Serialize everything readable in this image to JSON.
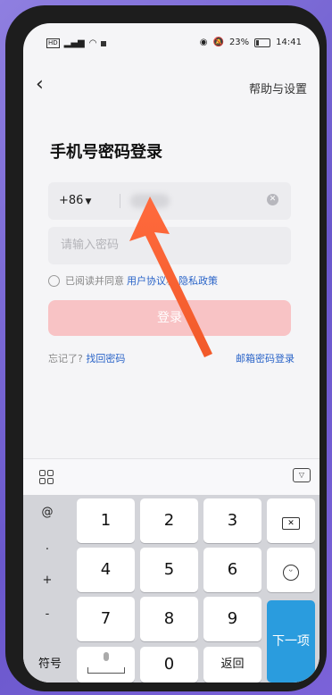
{
  "status_bar": {
    "left_badge": "HD",
    "battery_percent": "23%",
    "time": "14:41"
  },
  "header": {
    "back_glyph": "‹",
    "help_settings": "帮助与设置"
  },
  "login": {
    "title": "手机号密码登录",
    "country_code": "+86",
    "password_placeholder": "请输入密码",
    "agree_prefix": "已阅读并同意",
    "user_agreement": "用户协议",
    "and": "和",
    "privacy_policy": "隐私政策",
    "login_button": "登录",
    "forgot_prefix": "忘记了?",
    "recover_password": "找回密码",
    "email_login": "邮箱密码登录"
  },
  "keyboard": {
    "side_keys": [
      "@",
      ".",
      "+",
      "-"
    ],
    "digits_row1": [
      "1",
      "2",
      "3"
    ],
    "digits_row2": [
      "4",
      "5",
      "6"
    ],
    "digits_row3": [
      "7",
      "8",
      "9"
    ],
    "symbols_key": "符号",
    "zero_key": "0",
    "return_key": "返回",
    "next_key": "下一项"
  }
}
